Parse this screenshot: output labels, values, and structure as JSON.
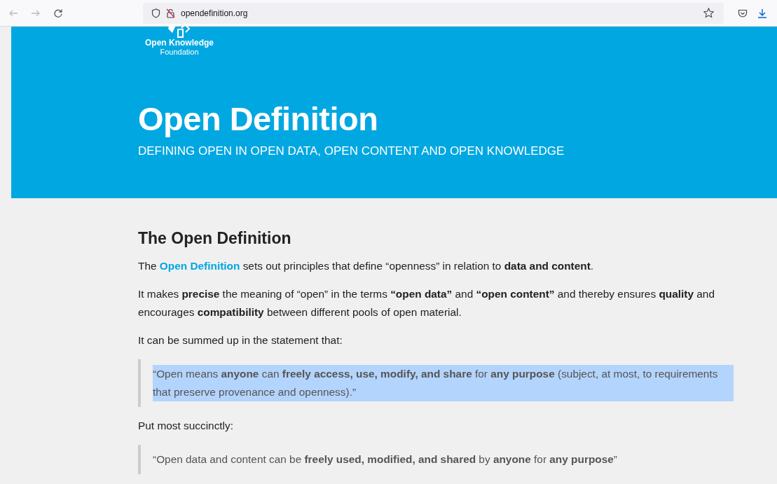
{
  "browser": {
    "url": "opendefinition.org"
  },
  "header": {
    "logo_line1": "Open Knowledge",
    "logo_line2": "Foundation",
    "title": "Open Definition",
    "subtitle": "DEFINING OPEN IN OPEN DATA, OPEN CONTENT AND OPEN KNOWLEDGE"
  },
  "article": {
    "heading": "The Open Definition",
    "blocks": [
      {
        "kind": "link-paragraph",
        "before": "The ",
        "link": "Open Definition",
        "after": " sets out principles that define “openness” in relation to **data and content**."
      },
      {
        "kind": "paragraph",
        "text": "It makes **precise** the meaning of “open” in the terms **“open data”** and **“open content”** and thereby ensures **quality** and encourages **compatibility** between different pools of open material."
      },
      {
        "kind": "paragraph",
        "text": "It can be summed up in the statement that:"
      },
      {
        "kind": "quote",
        "highlighted": true,
        "text": "“Open means **anyone** can **freely access, use, modify, and share** for **any purpose** (subject, at most, to requirements that preserve provenance and openness).”"
      },
      {
        "kind": "paragraph",
        "text": "Put most succinctly:"
      },
      {
        "kind": "quote",
        "highlighted": false,
        "text": "“Open data and content can be **freely used, modified, and shared** by **anyone** for **any purpose**”"
      }
    ]
  }
}
